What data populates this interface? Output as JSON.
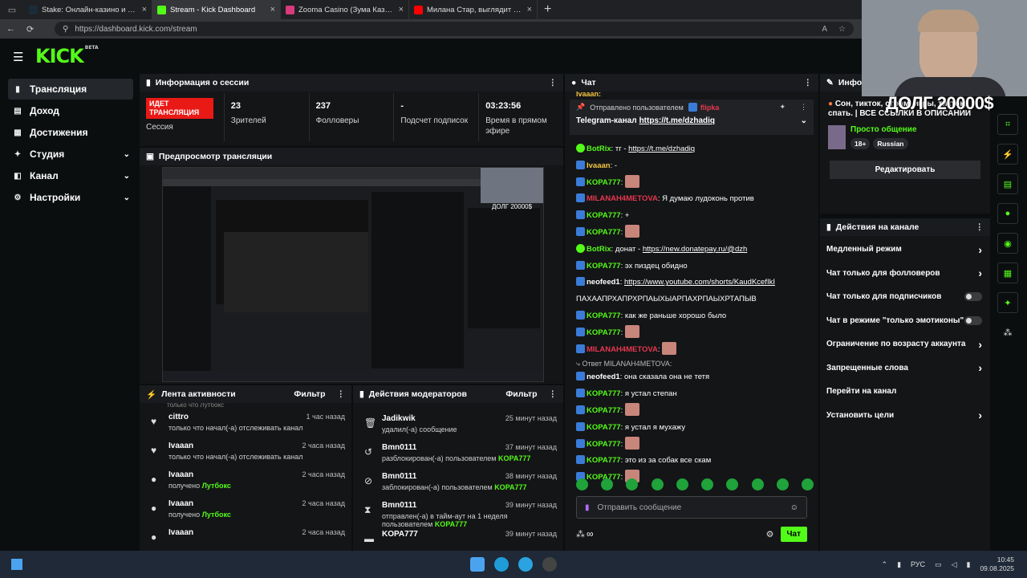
{
  "browser": {
    "tabs": [
      {
        "title": "Stake: Онлайн-казино и ставки на спорт",
        "color": "#1a2c38",
        "active": false
      },
      {
        "title": "Stream - Kick Dashboard",
        "color": "#53fc18",
        "active": true
      },
      {
        "title": "Zooma Casino (Зума Казино) оф",
        "color": "#d93a7b",
        "active": false
      },
      {
        "title": "Милана Стар, выглядит старше",
        "color": "#ff0000",
        "active": false
      }
    ],
    "url": "https://dashboard.kick.com/stream"
  },
  "logo": {
    "text": "KICK",
    "beta": "BETA"
  },
  "sidebar": {
    "items": [
      {
        "label": "Трансляция",
        "icon": "▮",
        "active": true,
        "chevron": false
      },
      {
        "label": "Доход",
        "icon": "▤",
        "active": false,
        "chevron": false
      },
      {
        "label": "Достижения",
        "icon": "▦",
        "active": false,
        "chevron": false
      },
      {
        "label": "Студия",
        "icon": "✦",
        "active": false,
        "chevron": true
      },
      {
        "label": "Канал",
        "icon": "◧",
        "active": false,
        "chevron": true
      },
      {
        "label": "Настройки",
        "icon": "⚙",
        "active": false,
        "chevron": true
      }
    ]
  },
  "session": {
    "title": "Информация о сессии",
    "live_badge": "ИДЕТ ТРАНСЛЯЦИЯ",
    "session_label": "Сессия",
    "viewers": "23",
    "viewers_label": "Зрителей",
    "followers": "237",
    "followers_label": "Фолловеры",
    "subs": "-",
    "subs_label": "Подсчет подписок",
    "time": "03:23:56",
    "time_label": "Время в прямом эфире"
  },
  "preview": {
    "title": "Предпросмотр трансляции",
    "overlay": "ДОЛГ 20000$"
  },
  "feed": {
    "title": "Лента активности",
    "filter": "Фильтр",
    "partial": "только что Лутбокс",
    "items": [
      {
        "icon": "♥",
        "name": "cittro",
        "time": "1 час назад",
        "text": "только что начал(-а) отслеживать канал",
        "hl": ""
      },
      {
        "icon": "♥",
        "name": "Ivaaan",
        "time": "2 часа назад",
        "text": "только что начал(-а) отслеживать канал",
        "hl": ""
      },
      {
        "icon": "●",
        "name": "Ivaaan",
        "time": "2 часа назад",
        "text": "получено ",
        "hl": "Лутбокс"
      },
      {
        "icon": "●",
        "name": "Ivaaan",
        "time": "2 часа назад",
        "text": "получено ",
        "hl": "Лутбокс"
      },
      {
        "icon": "●",
        "name": "Ivaaan",
        "time": "2 часа назад",
        "text": "",
        "hl": ""
      }
    ]
  },
  "mods": {
    "title": "Действия модераторов",
    "filter": "Фильтр",
    "items": [
      {
        "icon": "🗑",
        "name": "Jadikwik",
        "time": "25 минут назад",
        "text": "удалил(-а) сообщение",
        "hl": ""
      },
      {
        "icon": "↺",
        "name": "Bmn0111",
        "time": "37 минут назад",
        "text": "разблокирован(-а) пользователем ",
        "hl": "KOPA777"
      },
      {
        "icon": "⊘",
        "name": "Bmn0111",
        "time": "38 минут назад",
        "text": "заблокирован(-а) пользователем ",
        "hl": "KOPA777"
      },
      {
        "icon": "⧗",
        "name": "Bmn0111",
        "time": "39 минут назад",
        "text": "отправлен(-а) в тайм-аут на 1 неделя пользователем ",
        "hl": "KOPA777"
      },
      {
        "icon": "▬",
        "name": "KOPA777",
        "time": "39 минут назад",
        "text": "",
        "hl": ""
      }
    ]
  },
  "chat": {
    "title": "Чат",
    "top_partial": "Ivaaan:",
    "pinned_by": "Отправлено пользователем",
    "pinned_user": "flipka",
    "pinned_text": "Telegram-канал",
    "pinned_link": "https://t.me/dzhadiq",
    "messages": [
      {
        "user": "BotRix",
        "color": "#53fc18",
        "bot": true,
        "text": "тг - ",
        "link": "https://t.me/dzhadiq",
        "emote": false
      },
      {
        "user": "Ivaaan",
        "color": "#f5c542",
        "bot": false,
        "text": "-",
        "link": "",
        "emote": false
      },
      {
        "user": "KOPA777",
        "color": "#53fc18",
        "bot": false,
        "text": "",
        "link": "",
        "emote": true
      },
      {
        "user": "MILANAH4METOVA",
        "color": "#e5384f",
        "bot": false,
        "text": "Я думаю лудоконь против",
        "link": "",
        "emote": false
      },
      {
        "user": "KOPA777",
        "color": "#53fc18",
        "bot": false,
        "text": "+",
        "link": "",
        "emote": false
      },
      {
        "user": "KOPA777",
        "color": "#53fc18",
        "bot": false,
        "text": "",
        "link": "",
        "emote": true
      },
      {
        "user": "BotRix",
        "color": "#53fc18",
        "bot": true,
        "text": "донат - ",
        "link": "https://new.donatepay.ru/@dzh",
        "emote": false
      },
      {
        "user": "KOPA777",
        "color": "#53fc18",
        "bot": false,
        "text": "эх пиздец обидно",
        "link": "",
        "emote": false
      },
      {
        "user": "neofeed1",
        "color": "#ffffff",
        "bot": false,
        "text": "",
        "link": "https://www.youtube.com/shorts/KaudKcefIkI",
        "emote": false
      },
      {
        "user": "",
        "color": "#ffffff",
        "bot": false,
        "text": "ПАХААПРХАПРХРПАЫХЫАРПАХРПАЫХРТАПЫВ",
        "link": "",
        "emote": false
      },
      {
        "user": "KOPA777",
        "color": "#53fc18",
        "bot": false,
        "text": "как же раньше хорошо было",
        "link": "",
        "emote": false
      },
      {
        "user": "KOPA777",
        "color": "#53fc18",
        "bot": false,
        "text": "",
        "link": "",
        "emote": true
      },
      {
        "user": "MILANAH4METOVA",
        "color": "#e5384f",
        "bot": false,
        "text": "",
        "link": "",
        "emote": true
      }
    ],
    "reply_text": "Ответ MILANAH4METOVA:",
    "messages2": [
      {
        "user": "neofeed1",
        "color": "#ffffff",
        "text": "она сказала она не тетя",
        "emote": false
      },
      {
        "user": "KOPA777",
        "color": "#53fc18",
        "text": "я устал степан",
        "emote": false
      },
      {
        "user": "KOPA777",
        "color": "#53fc18",
        "text": "",
        "emote": true
      },
      {
        "user": "KOPA777",
        "color": "#53fc18",
        "text": "я устал я мухажу",
        "emote": false
      },
      {
        "user": "KOPA777",
        "color": "#53fc18",
        "text": "",
        "emote": true
      },
      {
        "user": "KOPA777",
        "color": "#53fc18",
        "text": "это из за собак все скам",
        "emote": false
      },
      {
        "user": "KOPA777",
        "color": "#53fc18",
        "text": "",
        "emote": true
      }
    ],
    "placeholder": "Отправить сообщение",
    "send": "Чат",
    "infinity": "∞"
  },
  "info": {
    "title": "Инфор",
    "stream_title": "Сон, тикток, стрим, игры, тикток, спать. | ВСЕ ССЫЛКИ В ОПИСАНИИ",
    "category": "Просто общение",
    "tags": [
      "18+",
      "Russian"
    ],
    "edit": "Редактировать"
  },
  "actions": {
    "title": "Действия на канале",
    "items": [
      {
        "label": "Медленный режим",
        "kind": "chev"
      },
      {
        "label": "Чат только для фолловеров",
        "kind": "chev"
      },
      {
        "label": "Чат только для подписчиков",
        "kind": "toggle"
      },
      {
        "label": "Чат в режиме \"только эмотиконы\"",
        "kind": "toggle"
      },
      {
        "label": "Ограничение по возрасту аккаунта",
        "kind": "chev"
      },
      {
        "label": "Запрещенные слова",
        "kind": "chev"
      },
      {
        "label": "Перейти на канал",
        "kind": "none"
      },
      {
        "label": "Установить цели",
        "kind": "chev"
      }
    ]
  },
  "overlay": {
    "text": "ДОЛГ 20000$"
  },
  "taskbar": {
    "lang": "РУС",
    "time": "10:45",
    "date": "09.08.2025"
  }
}
